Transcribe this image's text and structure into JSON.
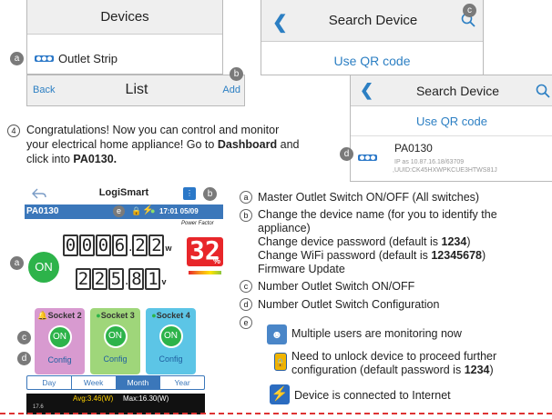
{
  "devices_panel": {
    "title": "Devices",
    "item_label": "Outlet Strip",
    "callout": "a"
  },
  "list_bar": {
    "back": "Back",
    "title": "List",
    "add": "Add",
    "callout": "b"
  },
  "search_panel_1": {
    "title": "Search Device",
    "qr": "Use QR code",
    "callout": "c"
  },
  "search_panel_2": {
    "title": "Search Device",
    "qr": "Use QR code",
    "device_name": "PA0130",
    "device_info_line1": "IP as 10.87.16.18/63709",
    "device_info_line2": ",UUID:CK45HXWPKCUE3HTWS81J",
    "callout": "d"
  },
  "step4": {
    "number": "4",
    "line1": "Congratulations! Now you can control and monitor",
    "line2_pre": "your electrical home appliance! Go to ",
    "line2_bold": "Dashboard",
    "line2_post": " and",
    "line3_pre": "click into ",
    "line3_bold": "PA0130."
  },
  "phone": {
    "app_title": "LogiSmart",
    "device_id": "PA0130",
    "time": "17:01 05/09",
    "callout_e": "e",
    "callout_b": "b",
    "main_on": "ON",
    "callout_a": "a",
    "power_digits": [
      "0",
      "0",
      "0",
      "6"
    ],
    "power_dec": [
      "2",
      "2"
    ],
    "power_unit": "w",
    "voltage_digits": [
      "2",
      "2",
      "5"
    ],
    "voltage_dec": [
      "8",
      "1"
    ],
    "voltage_unit": "v",
    "pf_label": "Power Factor",
    "pf_value": "32",
    "pf_unit": "%",
    "sockets": [
      {
        "label": "Socket 2",
        "on": "ON",
        "config": "Config",
        "color": "#d89ad0"
      },
      {
        "label": "Socket 3",
        "on": "ON",
        "config": "Config",
        "color": "#9fd67a"
      },
      {
        "label": "Socket 4",
        "on": "ON",
        "config": "Config",
        "color": "#5cc5e6"
      }
    ],
    "callout_c": "c",
    "callout_d": "d",
    "tabs": [
      "Day",
      "Week",
      "Month",
      "Year"
    ],
    "active_tab": "Month",
    "chart_avg": "Avg:3.46(W)",
    "chart_max": "Max:16.30(W)",
    "chart_tick": "17.6"
  },
  "legend": {
    "a": {
      "letter": "a",
      "text_pre": "Master Outlet Switch ON/OFF (All switches)"
    },
    "b": {
      "letter": "b",
      "line1": "Change the device name (for you to identify the",
      "line2": "appliance)",
      "line3_pre": "Change device password (default is ",
      "line3_bold": "1234",
      "line3_post": ")",
      "line4_pre": "Change WiFi password (default is ",
      "line4_bold": "12345678",
      "line4_post": ")",
      "line5": "Firmware Update"
    },
    "c": {
      "letter": "c",
      "text": "Number Outlet Switch ON/OFF"
    },
    "d": {
      "letter": "d",
      "text": "Number Outlet Switch Configuration"
    },
    "e": {
      "letter": "e",
      "users": "Multiple users are monitoring now",
      "lock_line1": "Need to unlock device to proceed further",
      "lock_line2_pre": "configuration (default password is ",
      "lock_line2_bold": "1234",
      "lock_line2_post": ")",
      "internet": "Device is connected to Internet"
    }
  }
}
